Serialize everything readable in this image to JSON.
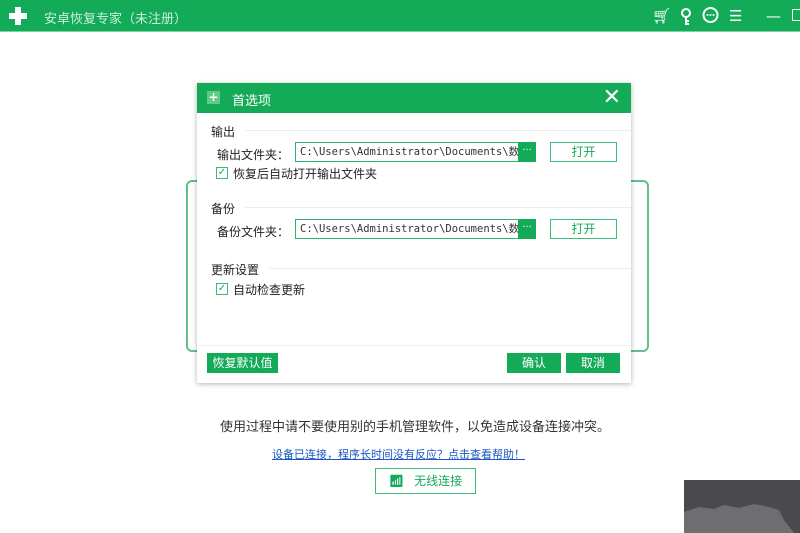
{
  "app": {
    "title": "安卓恢复专家（未注册）",
    "icons": [
      "cart-icon",
      "key-icon",
      "chat-icon",
      "menu-icon",
      "minimize-icon",
      "maximize-icon"
    ]
  },
  "dialog": {
    "title": "首选项",
    "close": "✕",
    "output": {
      "section": "输出",
      "label": "输出文件夹：",
      "path": "C:\\Users\\Administrator\\Documents\\数",
      "dots": "···",
      "open": "打开",
      "checkbox": "恢复后自动打开输出文件夹"
    },
    "backup": {
      "section": "备份",
      "label": "备份文件夹：",
      "path": "C:\\Users\\Administrator\\Documents\\数",
      "dots": "···",
      "open": "打开"
    },
    "update": {
      "section": "更新设置",
      "checkbox": "自动检查更新"
    },
    "reset": "恢复默认值",
    "ok": "确认",
    "cancel": "取消"
  },
  "main": {
    "notice": "使用过程中请不要使用别的手机管理软件，以免造成设备连接冲突。",
    "help_link": "设备已连接，程序长时间没有反应？点击查看帮助！",
    "wireless": "无线连接"
  },
  "colors": {
    "brand": "#13aa58"
  }
}
